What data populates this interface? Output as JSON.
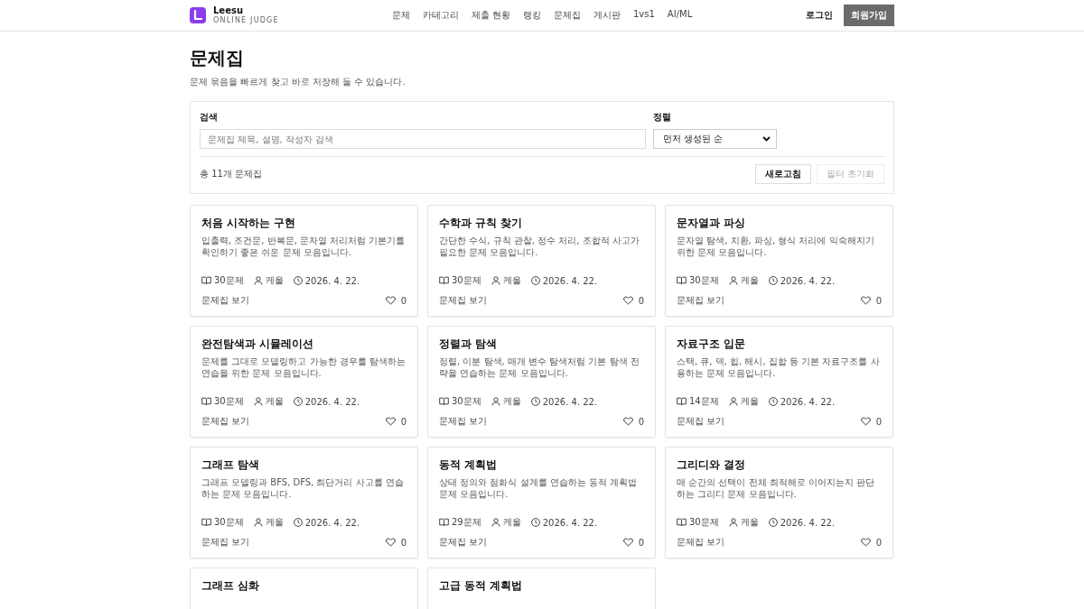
{
  "brand": {
    "name": "Leesu",
    "subtitle": "ONLINE JUDGE"
  },
  "nav": [
    {
      "label": "문제",
      "selected": false
    },
    {
      "label": "카테고리",
      "selected": false
    },
    {
      "label": "제출 현황",
      "selected": false
    },
    {
      "label": "랭킹",
      "selected": false
    },
    {
      "label": "문제집",
      "selected": false
    },
    {
      "label": "게시판",
      "selected": false
    },
    {
      "label": "1vs1",
      "selected": false
    },
    {
      "label": "AI/ML",
      "selected": false
    }
  ],
  "auth": {
    "login": "로그인",
    "signup": "회원가입"
  },
  "page": {
    "title": "문제집",
    "subtitle": "문제 묶음을 빠르게 찾고 바로 저장해 둘 수 있습니다."
  },
  "filters": {
    "search_label": "검색",
    "search_placeholder": "문제집 제목, 설명, 작성자 검색",
    "sort_label": "정렬",
    "sort_value": "먼저 생성된 순",
    "total": "총 11개 문제집",
    "refresh": "새로고침",
    "reset": "필터 초기화"
  },
  "cards": [
    {
      "title": "처음 시작하는 구현",
      "description": "입출력, 조건문, 반복문, 문자열 처리처럼 기본기를 확인하기 좋은 쉬운 문제 모음입니다.",
      "count": "30문제",
      "author": "케울",
      "date": "2026. 4. 22.",
      "link": "문제집 보기",
      "likes": "0"
    },
    {
      "title": "수학과 규칙 찾기",
      "description": "간단한 수식, 규칙 관찰, 정수 처리, 조합적 사고가 필요한 문제 모음입니다.",
      "count": "30문제",
      "author": "케울",
      "date": "2026. 4. 22.",
      "link": "문제집 보기",
      "likes": "0"
    },
    {
      "title": "문자열과 파싱",
      "description": "문자열 탐색, 치환, 파싱, 형식 처리에 익숙해지기 위한 문제 모음입니다.",
      "count": "30문제",
      "author": "케울",
      "date": "2026. 4. 22.",
      "link": "문제집 보기",
      "likes": "0"
    },
    {
      "title": "완전탐색과 시뮬레이션",
      "description": "문제를 그대로 모델링하고 가능한 경우를 탐색하는 연습을 위한 문제 모음입니다.",
      "count": "30문제",
      "author": "케울",
      "date": "2026. 4. 22.",
      "link": "문제집 보기",
      "likes": "0"
    },
    {
      "title": "정렬과 탐색",
      "description": "정렬, 이분 탐색, 매개 변수 탐색처럼 기본 탐색 전략을 연습하는 문제 모음입니다.",
      "count": "30문제",
      "author": "케울",
      "date": "2026. 4. 22.",
      "link": "문제집 보기",
      "likes": "0"
    },
    {
      "title": "자료구조 입문",
      "description": "스택, 큐, 덱, 힙, 해시, 집합 등 기본 자료구조를 사용하는 문제 모음입니다.",
      "count": "14문제",
      "author": "케울",
      "date": "2026. 4. 22.",
      "link": "문제집 보기",
      "likes": "0"
    },
    {
      "title": "그래프 탐색",
      "description": "그래프 모델링과 BFS, DFS, 최단거리 사고를 연습하는 문제 모음입니다.",
      "count": "30문제",
      "author": "케울",
      "date": "2026. 4. 22.",
      "link": "문제집 보기",
      "likes": "0"
    },
    {
      "title": "동적 계획법",
      "description": "상태 정의와 점화식 설계를 연습하는 동적 계획법 문제 모음입니다.",
      "count": "29문제",
      "author": "케울",
      "date": "2026. 4. 22.",
      "link": "문제집 보기",
      "likes": "0"
    },
    {
      "title": "그리디와 결정",
      "description": "매 순간의 선택이 전체 최적해로 이어지는지 판단하는 그리디 문제 모음입니다.",
      "count": "30문제",
      "author": "케울",
      "date": "2026. 4. 22.",
      "link": "문제집 보기",
      "likes": "0"
    },
    {
      "title": "그래프 심화"
    },
    {
      "title": "고급 동적 계획법"
    }
  ]
}
